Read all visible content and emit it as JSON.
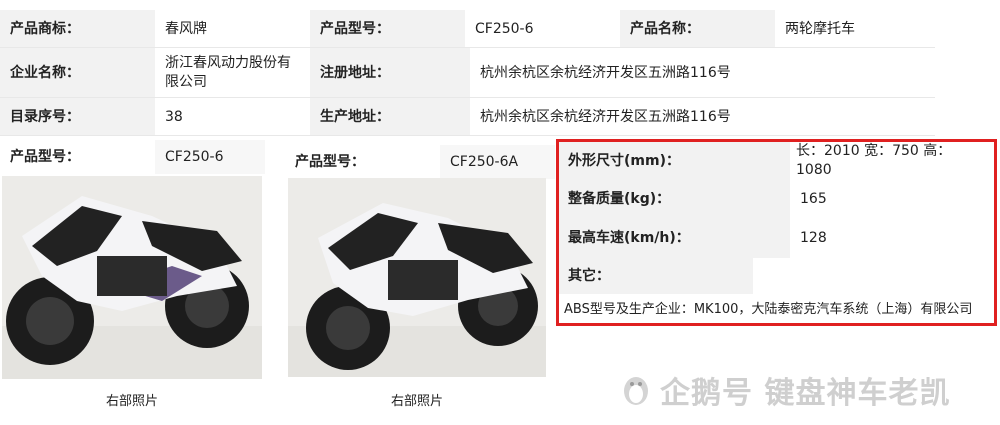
{
  "info_table": {
    "row1": {
      "brand_label": "产品商标：",
      "brand_value": "春风牌",
      "model_label": "产品型号：",
      "model_value": "CF250-6",
      "name_label": "产品名称：",
      "name_value": "两轮摩托车"
    },
    "row2": {
      "company_label": "企业名称：",
      "company_value": "浙江春风动力股份有限公司",
      "reg_addr_label": "注册地址：",
      "reg_addr_value": "杭州余杭区余杭经济开发区五洲路116号"
    },
    "row3": {
      "catalog_label": "目录序号：",
      "catalog_value": "38",
      "prod_addr_label": "生产地址：",
      "prod_addr_value": "杭州余杭区余杭经济开发区五洲路116号"
    }
  },
  "photo_left": {
    "model_label": "产品型号：",
    "model_value": "CF250-6",
    "caption": "右部照片"
  },
  "photo_right": {
    "model_label": "产品型号：",
    "model_value": "CF250-6A",
    "caption": "右部照片"
  },
  "specs": {
    "dim_label": "外形尺寸(mm)：",
    "dim_value": "长：2010 宽：750 高：1080",
    "mass_label": "整备质量(kg)：",
    "mass_value": "165",
    "speed_label": "最高车速(km/h)：",
    "speed_value": "128",
    "other_label": "其它：",
    "other_value": "ABS型号及生产企业：MK100，大陆泰密克汽车系统（上海）有限公司"
  },
  "watermark": {
    "text": "企鹅号 键盘神车老凯"
  },
  "colors": {
    "label_bg": "#f2f2f2",
    "highlight_border": "#e02020",
    "watermark": "#cfcfcf"
  }
}
